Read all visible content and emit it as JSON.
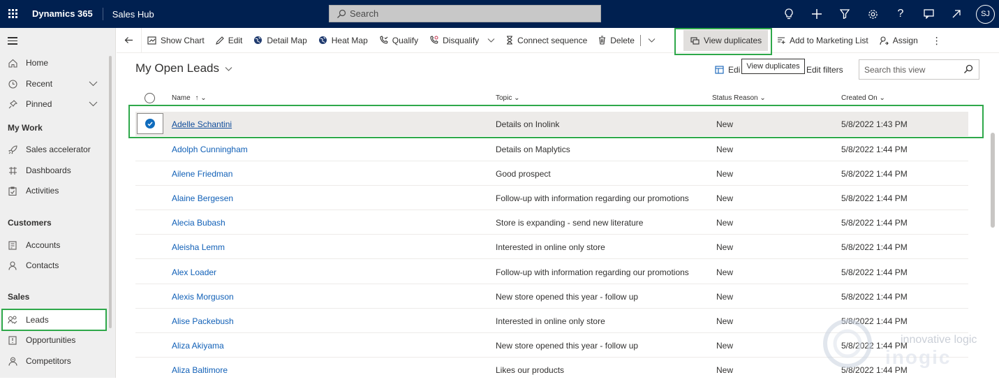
{
  "topbar": {
    "brand": "Dynamics 365",
    "app": "Sales Hub",
    "search_placeholder": "Search",
    "user_initials": "SJ"
  },
  "sidebar": {
    "items": [
      {
        "label": "Home",
        "icon": "home-icon"
      },
      {
        "label": "Recent",
        "icon": "clock-icon"
      },
      {
        "label": "Pinned",
        "icon": "pin-icon"
      },
      {
        "group": "My Work"
      },
      {
        "label": "Sales accelerator",
        "icon": "rocket-icon"
      },
      {
        "label": "Dashboards",
        "icon": "dashboard-icon"
      },
      {
        "label": "Activities",
        "icon": "clipboard-icon"
      },
      {
        "group": "Customers"
      },
      {
        "label": "Accounts",
        "icon": "building-icon"
      },
      {
        "label": "Contacts",
        "icon": "person-icon"
      },
      {
        "group": "Sales"
      },
      {
        "label": "Leads",
        "icon": "leads-icon"
      },
      {
        "label": "Opportunities",
        "icon": "opportunity-icon"
      },
      {
        "label": "Competitors",
        "icon": "competitor-icon"
      }
    ]
  },
  "commandbar": {
    "show_chart": "Show Chart",
    "edit": "Edit",
    "detail_map": "Detail Map",
    "heat_map": "Heat Map",
    "qualify": "Qualify",
    "disqualify": "Disqualify",
    "connect_sequence": "Connect sequence",
    "delete": "Delete",
    "view_duplicates": "View duplicates",
    "add_marketing": "Add to Marketing List",
    "assign": "Assign"
  },
  "tooltip": "View duplicates",
  "view": {
    "title": "My Open Leads",
    "edit_columns": "Edi",
    "edit_filters": "Edit filters",
    "search_placeholder": "Search this view"
  },
  "columns": {
    "name": "Name",
    "topic": "Topic",
    "status": "Status Reason",
    "created": "Created On"
  },
  "rows": [
    {
      "name": "Adelle Schantini",
      "topic": "Details on Inolink",
      "status": "New",
      "created": "5/8/2022 1:43 PM"
    },
    {
      "name": "Adolph Cunningham",
      "topic": "Details on Maplytics",
      "status": "New",
      "created": "5/8/2022 1:44 PM"
    },
    {
      "name": "Ailene Friedman",
      "topic": "Good prospect",
      "status": "New",
      "created": "5/8/2022 1:44 PM"
    },
    {
      "name": "Alaine Bergesen",
      "topic": "Follow-up with information regarding our promotions",
      "status": "New",
      "created": "5/8/2022 1:44 PM"
    },
    {
      "name": "Alecia Bubash",
      "topic": "Store is expanding - send new literature",
      "status": "New",
      "created": "5/8/2022 1:44 PM"
    },
    {
      "name": "Aleisha Lemm",
      "topic": "Interested in online only store",
      "status": "New",
      "created": "5/8/2022 1:44 PM"
    },
    {
      "name": "Alex Loader",
      "topic": "Follow-up with information regarding our promotions",
      "status": "New",
      "created": "5/8/2022 1:44 PM"
    },
    {
      "name": "Alexis Morguson",
      "topic": "New store opened this year - follow up",
      "status": "New",
      "created": "5/8/2022 1:44 PM"
    },
    {
      "name": "Alise Packebush",
      "topic": "Interested in online only store",
      "status": "New",
      "created": "5/8/2022 1:44 PM"
    },
    {
      "name": "Aliza Akiyama",
      "topic": "New store opened this year - follow up",
      "status": "New",
      "created": "5/8/2022 1:44 PM"
    },
    {
      "name": "Aliza Baltimore",
      "topic": "Likes our products",
      "status": "New",
      "created": "5/8/2022 1:44 PM"
    }
  ],
  "watermark": {
    "line1": "innovative logic",
    "line2": "inogic"
  },
  "colors": {
    "topbar": "#002050",
    "highlight": "#2ea84a",
    "link": "#1160b7"
  }
}
